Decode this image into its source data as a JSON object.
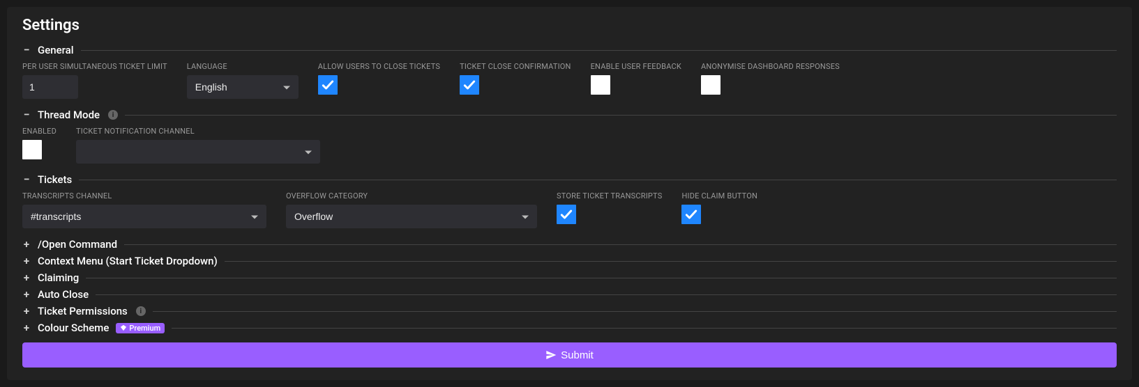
{
  "page": {
    "title": "Settings"
  },
  "sections": {
    "general": {
      "title": "General",
      "fields": {
        "ticket_limit": {
          "label": "PER USER SIMULTANEOUS TICKET LIMIT",
          "value": "1"
        },
        "language": {
          "label": "LANGUAGE",
          "value": "English"
        },
        "allow_close": {
          "label": "ALLOW USERS TO CLOSE TICKETS",
          "checked": true
        },
        "close_confirm": {
          "label": "TICKET CLOSE CONFIRMATION",
          "checked": true
        },
        "user_feedback": {
          "label": "ENABLE USER FEEDBACK",
          "checked": false
        },
        "anonymise": {
          "label": "ANONYMISE DASHBOARD RESPONSES",
          "checked": false
        }
      }
    },
    "thread_mode": {
      "title": "Thread Mode",
      "fields": {
        "enabled": {
          "label": "ENABLED",
          "checked": false
        },
        "notif_channel": {
          "label": "TICKET NOTIFICATION CHANNEL",
          "value": ""
        }
      }
    },
    "tickets": {
      "title": "Tickets",
      "fields": {
        "transcripts_channel": {
          "label": "TRANSCRIPTS CHANNEL",
          "value": "#transcripts"
        },
        "overflow_category": {
          "label": "OVERFLOW CATEGORY",
          "value": "Overflow"
        },
        "store_transcripts": {
          "label": "STORE TICKET TRANSCRIPTS",
          "checked": true
        },
        "hide_claim": {
          "label": "HIDE CLAIM BUTTON",
          "checked": true
        }
      }
    },
    "open_command": {
      "title": "/Open Command"
    },
    "context_menu": {
      "title": "Context Menu (Start Ticket Dropdown)"
    },
    "claiming": {
      "title": "Claiming"
    },
    "auto_close": {
      "title": "Auto Close"
    },
    "ticket_permissions": {
      "title": "Ticket Permissions"
    },
    "colour_scheme": {
      "title": "Colour Scheme",
      "badge": "Premium"
    }
  },
  "buttons": {
    "submit": "Submit"
  }
}
